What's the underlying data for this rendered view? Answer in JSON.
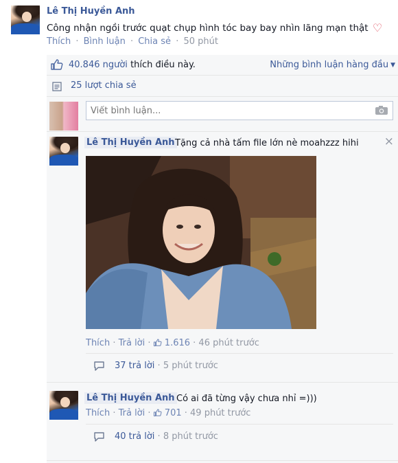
{
  "post": {
    "author": "Lê Thị Huyền Anh",
    "text": "Công nhận ngồi trước quạt chụp hình tóc bay bay nhìn lãng mạn thật",
    "heart": "♡",
    "actions": {
      "like": "Thích",
      "comment": "Bình luận",
      "share": "Chia sẻ",
      "time": "50 phút"
    },
    "dot": "·"
  },
  "ufi": {
    "likes_count": "40.846 người",
    "likes_suffix": "thích điều này.",
    "top_comments": "Những bình luận hàng đầu",
    "shares": "25 lượt chia sẻ",
    "compose_placeholder": "Viết bình luận..."
  },
  "comments": [
    {
      "author": "Lê Thị Huyền Anh",
      "text": "Tặng cả nhà tấm file lớn nè moahzzz hihi",
      "close": "×",
      "like": "Thích",
      "reply": "Trả lời",
      "like_count": "1.616",
      "time": "46 phút trước",
      "replies_count": "37 trả lời",
      "replies_time": "5 phút trước"
    },
    {
      "author": "Lê Thị Huyền Anh",
      "text": "Có ai đã từng vậy chưa nhỉ =)))",
      "like": "Thích",
      "reply": "Trả lời",
      "like_count": "701",
      "time": "49 phút trước",
      "replies_count": "40 trả lời",
      "replies_time": "8 phút trước"
    }
  ],
  "colors": {
    "link": "#3b5998",
    "muted": "#9197a3",
    "heart": "#e04f5f",
    "panel": "#f6f7f8"
  },
  "icons": [
    "thumbs-up-icon",
    "share-icon",
    "camera-icon",
    "close-icon",
    "reply-icon",
    "heart-icon",
    "caret-down-icon"
  ]
}
